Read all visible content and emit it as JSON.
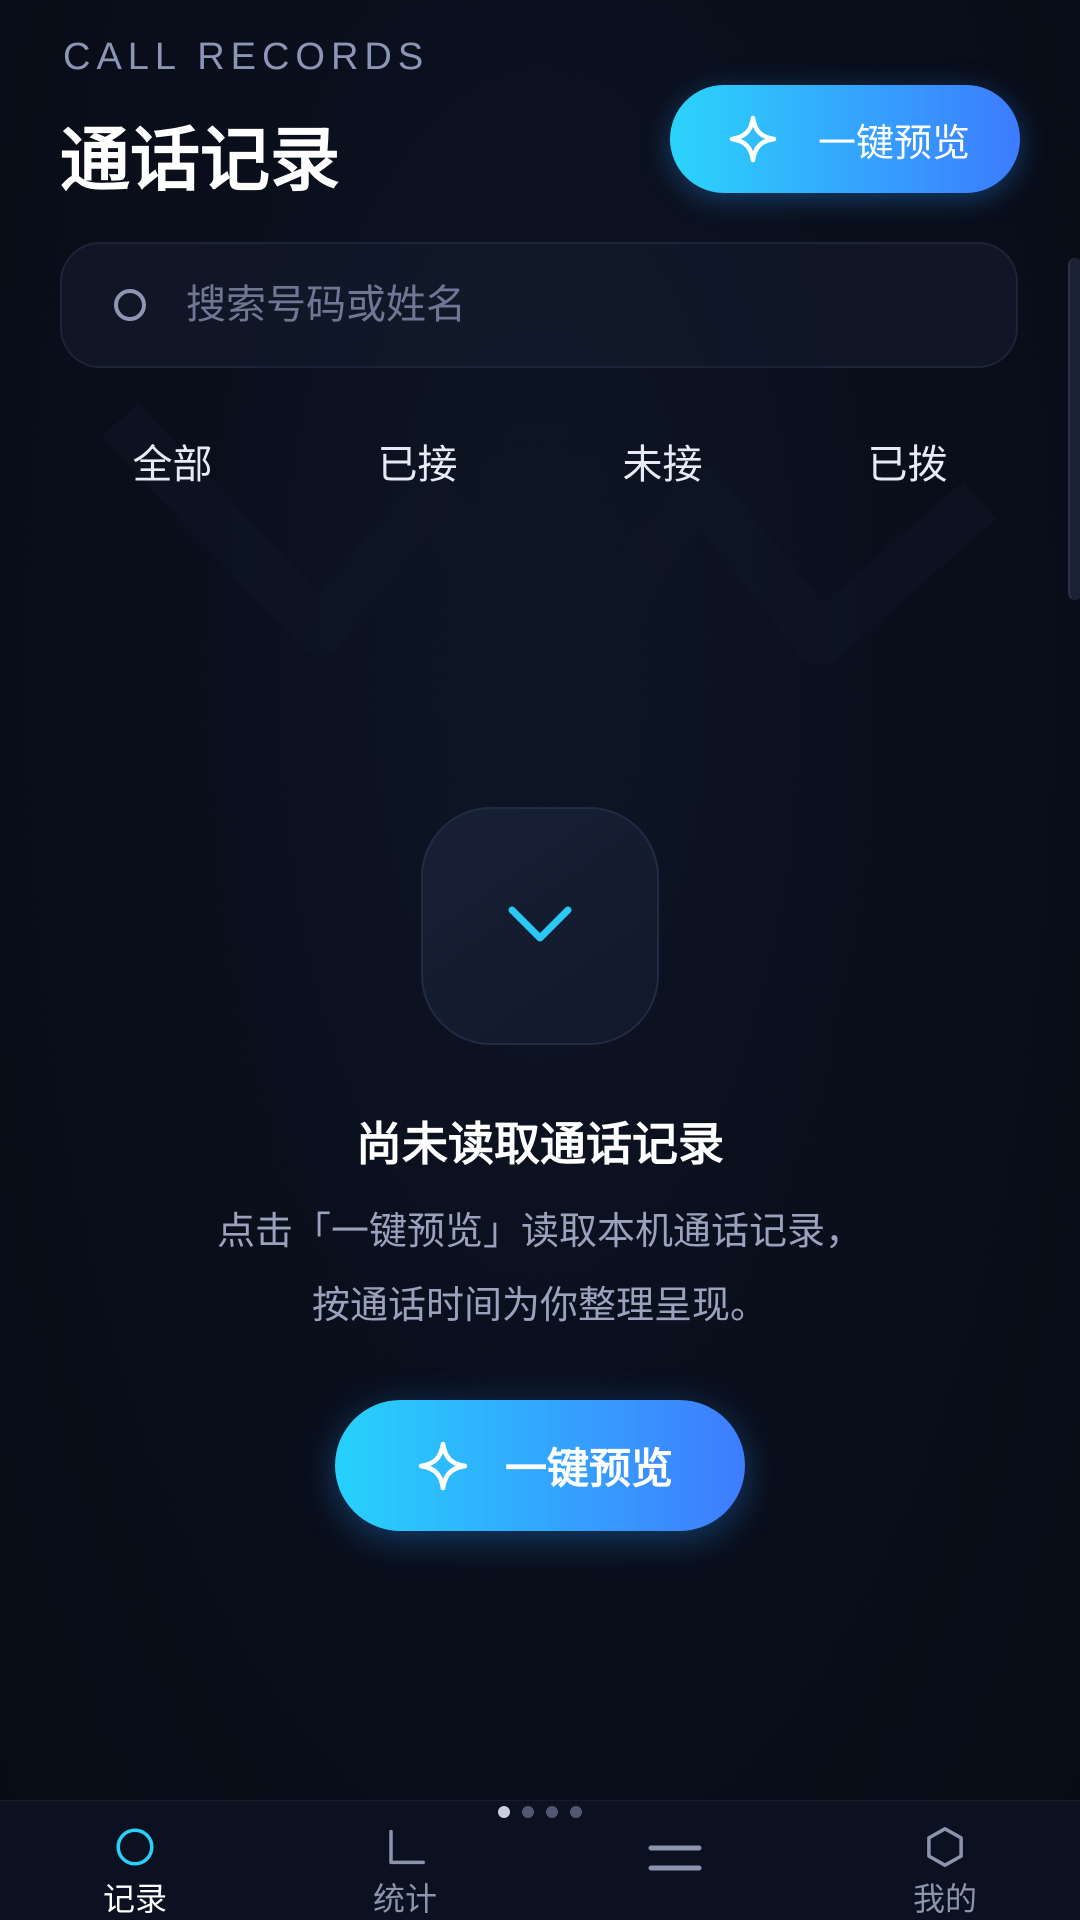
{
  "header": {
    "subtitle": "CALL RECORDS",
    "title": "通话记录",
    "preview_button_label": "一键预览"
  },
  "search": {
    "placeholder": "搜索号码或姓名",
    "value": ""
  },
  "tabs": [
    {
      "label": "全部"
    },
    {
      "label": "已接"
    },
    {
      "label": "未接"
    },
    {
      "label": "已拨"
    }
  ],
  "empty_state": {
    "title": "尚未读取通话记录",
    "description_line1": "点击「一键预览」读取本机通话记录，",
    "description_line2": "按通话时间为你整理呈现。",
    "button_label": "一键预览"
  },
  "bottom_nav": {
    "page_indicator": {
      "total": 4,
      "active": 1
    },
    "items": [
      {
        "label": "记录",
        "icon": "circle-icon"
      },
      {
        "label": "统计",
        "icon": "corner-icon"
      },
      {
        "label": "",
        "icon": "menu-icon"
      },
      {
        "label": "我的",
        "icon": "hexagon-icon"
      }
    ]
  },
  "colors": {
    "background": "#0a0f1c",
    "accent_start": "#2bd4fb",
    "accent_end": "#3d7bff",
    "chevron": "#2bc8f5",
    "muted_text": "#9aa2bd"
  }
}
